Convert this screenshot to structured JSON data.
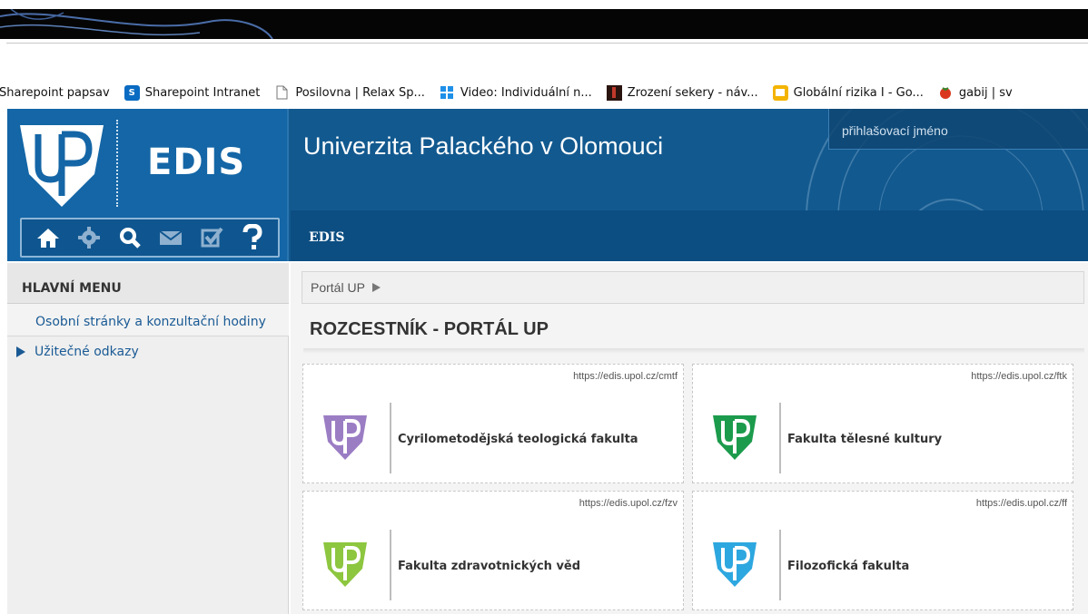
{
  "bookmarks": [
    {
      "label": "Sharepoint papsav",
      "icon": "none"
    },
    {
      "label": "Sharepoint Intranet",
      "icon": "sharepoint-icon"
    },
    {
      "label": "Posilovna | Relax Sp...",
      "icon": "page-icon"
    },
    {
      "label": "Video: Individuální n...",
      "icon": "windows-icon"
    },
    {
      "label": "Zrození sekery - náv...",
      "icon": "image-icon"
    },
    {
      "label": "Globální rizika I - Go...",
      "icon": "slides-icon"
    },
    {
      "label": "gabij | sv",
      "icon": "tomato-icon"
    }
  ],
  "header": {
    "app_name": "EDIS",
    "university": "Univerzita Palackého v Olomouci",
    "login_placeholder": "přihlašovací jméno",
    "nav_tab": "EDIS",
    "toolbar_icons": [
      "home-icon",
      "gear-icon",
      "search-icon",
      "mail-icon",
      "checkbox-icon",
      "help-icon"
    ]
  },
  "sidebar": {
    "title": "HLAVNÍ MENU",
    "items": [
      {
        "label": "Osobní stránky a konzultační hodiny"
      },
      {
        "label": "Užitečné odkazy"
      }
    ]
  },
  "main": {
    "breadcrumb": "Portál UP",
    "title": "ROZCESTNÍK - PORTÁL UP",
    "cards": [
      {
        "name": "Cyrilometodějská teologická fakulta",
        "url": "https://edis.upol.cz/cmtf",
        "color": "#9b7dc4"
      },
      {
        "name": "Fakulta tělesné kultury",
        "url": "https://edis.upol.cz/ftk",
        "color": "#1c9b4c"
      },
      {
        "name": "Fakulta zdravotnických věd",
        "url": "https://edis.upol.cz/fzv",
        "color": "#8dc63f"
      },
      {
        "name": "Filozofická fakulta",
        "url": "https://edis.upol.cz/ff",
        "color": "#2da7df"
      }
    ]
  },
  "colors": {
    "header_blue": "#12598f",
    "logo_blue": "#1466a6",
    "link_blue": "#1a5a94"
  }
}
